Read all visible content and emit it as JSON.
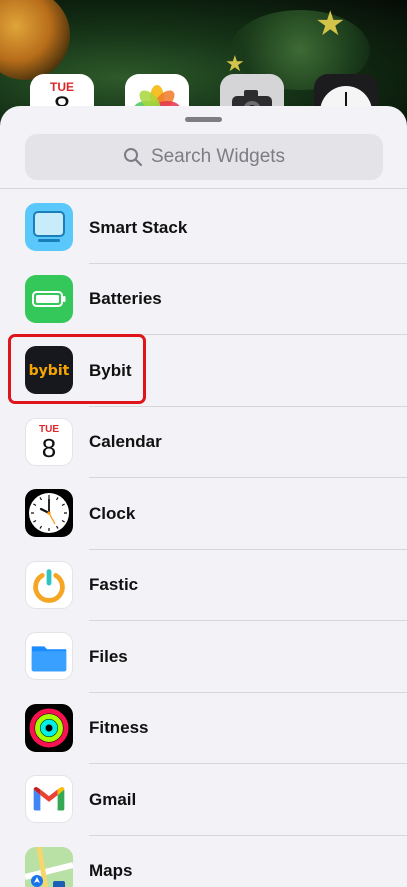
{
  "home_screen": {
    "calendar_peek": {
      "day": "TUE",
      "num": "8"
    }
  },
  "sheet": {
    "search": {
      "placeholder": "Search Widgets",
      "icon": "search-icon"
    }
  },
  "widgets": [
    {
      "label": "Smart Stack",
      "icon": "smart-stack-icon",
      "color": "#5ac8fa"
    },
    {
      "label": "Batteries",
      "icon": "battery-icon",
      "color": "#34c759"
    },
    {
      "label": "Bybit",
      "icon": "bybit-icon",
      "color": "#17181e",
      "highlighted": true,
      "highlight_color": "#e0151b"
    },
    {
      "label": "Calendar",
      "icon": "calendar-icon",
      "color": "#ffffff",
      "day": "TUE",
      "num": "8"
    },
    {
      "label": "Clock",
      "icon": "clock-icon",
      "color": "#000000"
    },
    {
      "label": "Fastic",
      "icon": "fastic-icon",
      "color": "#ffffff"
    },
    {
      "label": "Files",
      "icon": "files-icon",
      "color": "#1a8cff"
    },
    {
      "label": "Fitness",
      "icon": "fitness-icon",
      "color": "#000000"
    },
    {
      "label": "Gmail",
      "icon": "gmail-icon",
      "color": "#ffffff"
    },
    {
      "label": "Maps",
      "icon": "maps-icon",
      "color": "#c9e6b5"
    }
  ]
}
